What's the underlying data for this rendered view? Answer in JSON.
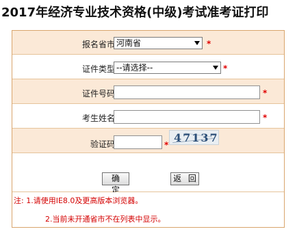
{
  "page_title": "2017年经济专业技术资格(中级)考试准考证打印",
  "form": {
    "province": {
      "label": "报名省市:",
      "value": "河南省",
      "required_mark": "*"
    },
    "id_type": {
      "label": "证件类型:",
      "value": "--请选择--",
      "required_mark": "*"
    },
    "id_number": {
      "label": "证件号码:",
      "value": "",
      "required_mark": "*"
    },
    "name": {
      "label": "考生姓名:",
      "value": "",
      "required_mark": "*"
    },
    "captcha": {
      "label": "验证码:",
      "value": "",
      "required_mark": "*",
      "image_text": "47137"
    }
  },
  "buttons": {
    "confirm": "确 定",
    "back": "返 回"
  },
  "notes": {
    "line1": "注: 1.请使用IE8.0及更高版本浏览器。",
    "line2": "2.当前未开通省市不在列表中显示。"
  },
  "colors": {
    "row_shade": "#fbe9d7",
    "border": "#d9a56c",
    "required": "#e00000",
    "note_text": "#d40000"
  }
}
